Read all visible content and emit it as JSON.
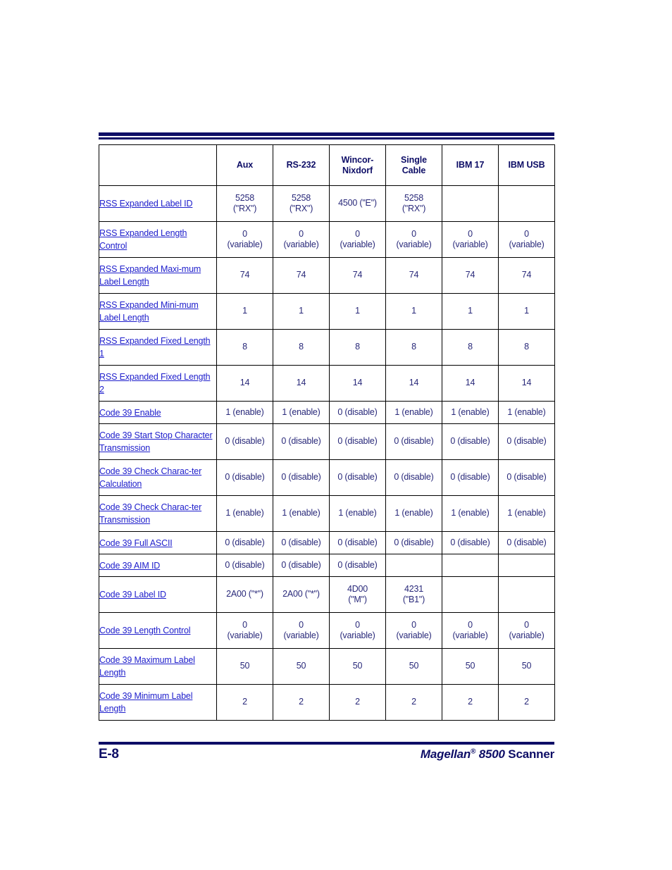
{
  "footer": {
    "page_number": "E-8",
    "title_italic_1": "Magellan",
    "title_registered": "®",
    "title_italic_2": " 8500",
    "title_plain": " Scanner"
  },
  "table": {
    "columns": [
      "",
      "Aux",
      "RS-232",
      "Wincor-Nixdorf",
      "Single Cable",
      "IBM 17",
      "IBM USB"
    ],
    "headers": [
      {
        "line1": "",
        "line2": ""
      },
      {
        "line1": "Aux",
        "line2": ""
      },
      {
        "line1": "RS-232",
        "line2": ""
      },
      {
        "line1": "Wincor-",
        "line2": "Nixdorf"
      },
      {
        "line1": "Single",
        "line2": "Cable"
      },
      {
        "line1": "IBM 17",
        "line2": ""
      },
      {
        "line1": "IBM USB",
        "line2": ""
      }
    ],
    "rows": [
      {
        "label": "RSS Expanded Label ID",
        "tall": true,
        "cells": [
          {
            "line1": "5258",
            "line2": "(\"RX\")"
          },
          {
            "line1": "5258",
            "line2": "(\"RX\")"
          },
          {
            "line1": "4500 (\"E\")",
            "line2": ""
          },
          {
            "line1": "5258",
            "line2": "(\"RX\")"
          },
          {
            "line1": "",
            "line2": ""
          },
          {
            "line1": "",
            "line2": ""
          }
        ]
      },
      {
        "label": "RSS Expanded Length Control",
        "tall": true,
        "cells": [
          {
            "line1": "0",
            "line2": "(variable)"
          },
          {
            "line1": "0",
            "line2": "(variable)"
          },
          {
            "line1": "0",
            "line2": "(variable)"
          },
          {
            "line1": "0",
            "line2": "(variable)"
          },
          {
            "line1": "0",
            "line2": "(variable)"
          },
          {
            "line1": "0",
            "line2": "(variable)"
          }
        ]
      },
      {
        "label": "RSS Expanded Maxi-mum Label Length",
        "tall": true,
        "cells": [
          {
            "line1": "74",
            "line2": ""
          },
          {
            "line1": "74",
            "line2": ""
          },
          {
            "line1": "74",
            "line2": ""
          },
          {
            "line1": "74",
            "line2": ""
          },
          {
            "line1": "74",
            "line2": ""
          },
          {
            "line1": "74",
            "line2": ""
          }
        ]
      },
      {
        "label": "RSS Expanded Mini-mum Label Length",
        "tall": true,
        "cells": [
          {
            "line1": "1",
            "line2": ""
          },
          {
            "line1": "1",
            "line2": ""
          },
          {
            "line1": "1",
            "line2": ""
          },
          {
            "line1": "1",
            "line2": ""
          },
          {
            "line1": "1",
            "line2": ""
          },
          {
            "line1": "1",
            "line2": ""
          }
        ]
      },
      {
        "label": "RSS Expanded Fixed Length 1",
        "tall": true,
        "cells": [
          {
            "line1": "8",
            "line2": ""
          },
          {
            "line1": "8",
            "line2": ""
          },
          {
            "line1": "8",
            "line2": ""
          },
          {
            "line1": "8",
            "line2": ""
          },
          {
            "line1": "8",
            "line2": ""
          },
          {
            "line1": "8",
            "line2": ""
          }
        ]
      },
      {
        "label": "RSS Expanded Fixed Length 2",
        "tall": true,
        "cells": [
          {
            "line1": "14",
            "line2": ""
          },
          {
            "line1": "14",
            "line2": ""
          },
          {
            "line1": "14",
            "line2": ""
          },
          {
            "line1": "14",
            "line2": ""
          },
          {
            "line1": "14",
            "line2": ""
          },
          {
            "line1": "14",
            "line2": ""
          }
        ]
      },
      {
        "label": "Code 39 Enable",
        "tall": false,
        "cells": [
          {
            "line1": "1 (enable)",
            "line2": ""
          },
          {
            "line1": "1 (enable)",
            "line2": ""
          },
          {
            "line1": "0 (disable)",
            "line2": ""
          },
          {
            "line1": "1 (enable)",
            "line2": ""
          },
          {
            "line1": "1 (enable)",
            "line2": ""
          },
          {
            "line1": "1 (enable)",
            "line2": ""
          }
        ]
      },
      {
        "label": "Code 39 Start Stop Character Transmission",
        "tall": true,
        "cells": [
          {
            "line1": "0 (disable)",
            "line2": ""
          },
          {
            "line1": "0 (disable)",
            "line2": ""
          },
          {
            "line1": "0 (disable)",
            "line2": ""
          },
          {
            "line1": "0 (disable)",
            "line2": ""
          },
          {
            "line1": "0 (disable)",
            "line2": ""
          },
          {
            "line1": "0 (disable)",
            "line2": ""
          }
        ]
      },
      {
        "label": "Code 39 Check Charac-ter Calculation",
        "tall": true,
        "cells": [
          {
            "line1": "0 (disable)",
            "line2": ""
          },
          {
            "line1": "0 (disable)",
            "line2": ""
          },
          {
            "line1": "0 (disable)",
            "line2": ""
          },
          {
            "line1": "0 (disable)",
            "line2": ""
          },
          {
            "line1": "0 (disable)",
            "line2": ""
          },
          {
            "line1": "0 (disable)",
            "line2": ""
          }
        ]
      },
      {
        "label": "Code 39 Check Charac-ter Transmission",
        "tall": true,
        "cells": [
          {
            "line1": "1 (enable)",
            "line2": ""
          },
          {
            "line1": "1 (enable)",
            "line2": ""
          },
          {
            "line1": "1 (enable)",
            "line2": ""
          },
          {
            "line1": "1 (enable)",
            "line2": ""
          },
          {
            "line1": "1 (enable)",
            "line2": ""
          },
          {
            "line1": "1 (enable)",
            "line2": ""
          }
        ]
      },
      {
        "label": "Code 39 Full ASCII",
        "tall": false,
        "cells": [
          {
            "line1": "0 (disable)",
            "line2": ""
          },
          {
            "line1": "0 (disable)",
            "line2": ""
          },
          {
            "line1": "0 (disable)",
            "line2": ""
          },
          {
            "line1": "0 (disable)",
            "line2": ""
          },
          {
            "line1": "0 (disable)",
            "line2": ""
          },
          {
            "line1": "0 (disable)",
            "line2": ""
          }
        ]
      },
      {
        "label": "Code 39 AIM ID",
        "tall": false,
        "cells": [
          {
            "line1": "0 (disable)",
            "line2": ""
          },
          {
            "line1": "0 (disable)",
            "line2": ""
          },
          {
            "line1": "0 (disable)",
            "line2": ""
          },
          {
            "line1": "",
            "line2": ""
          },
          {
            "line1": "",
            "line2": ""
          },
          {
            "line1": "",
            "line2": ""
          }
        ]
      },
      {
        "label": "Code 39 Label ID",
        "tall": true,
        "cells": [
          {
            "line1": "2A00 (\"*\")",
            "line2": ""
          },
          {
            "line1": "2A00 (\"*\")",
            "line2": ""
          },
          {
            "line1": "4D00",
            "line2": "(\"M\")"
          },
          {
            "line1": "4231",
            "line2": "(\"B1\")"
          },
          {
            "line1": "",
            "line2": ""
          },
          {
            "line1": "",
            "line2": ""
          }
        ]
      },
      {
        "label": "Code 39 Length Control",
        "tall": true,
        "cells": [
          {
            "line1": "0",
            "line2": "(variable)"
          },
          {
            "line1": "0",
            "line2": "(variable)"
          },
          {
            "line1": "0",
            "line2": "(variable)"
          },
          {
            "line1": "0",
            "line2": "(variable)"
          },
          {
            "line1": "0",
            "line2": "(variable)"
          },
          {
            "line1": "0",
            "line2": "(variable)"
          }
        ]
      },
      {
        "label": "Code 39 Maximum Label Length",
        "tall": true,
        "cells": [
          {
            "line1": "50",
            "line2": ""
          },
          {
            "line1": "50",
            "line2": ""
          },
          {
            "line1": "50",
            "line2": ""
          },
          {
            "line1": "50",
            "line2": ""
          },
          {
            "line1": "50",
            "line2": ""
          },
          {
            "line1": "50",
            "line2": ""
          }
        ]
      },
      {
        "label": "Code 39 Minimum Label Length",
        "tall": true,
        "cells": [
          {
            "line1": "2",
            "line2": ""
          },
          {
            "line1": "2",
            "line2": ""
          },
          {
            "line1": "2",
            "line2": ""
          },
          {
            "line1": "2",
            "line2": ""
          },
          {
            "line1": "2",
            "line2": ""
          },
          {
            "line1": "2",
            "line2": ""
          }
        ]
      }
    ]
  }
}
